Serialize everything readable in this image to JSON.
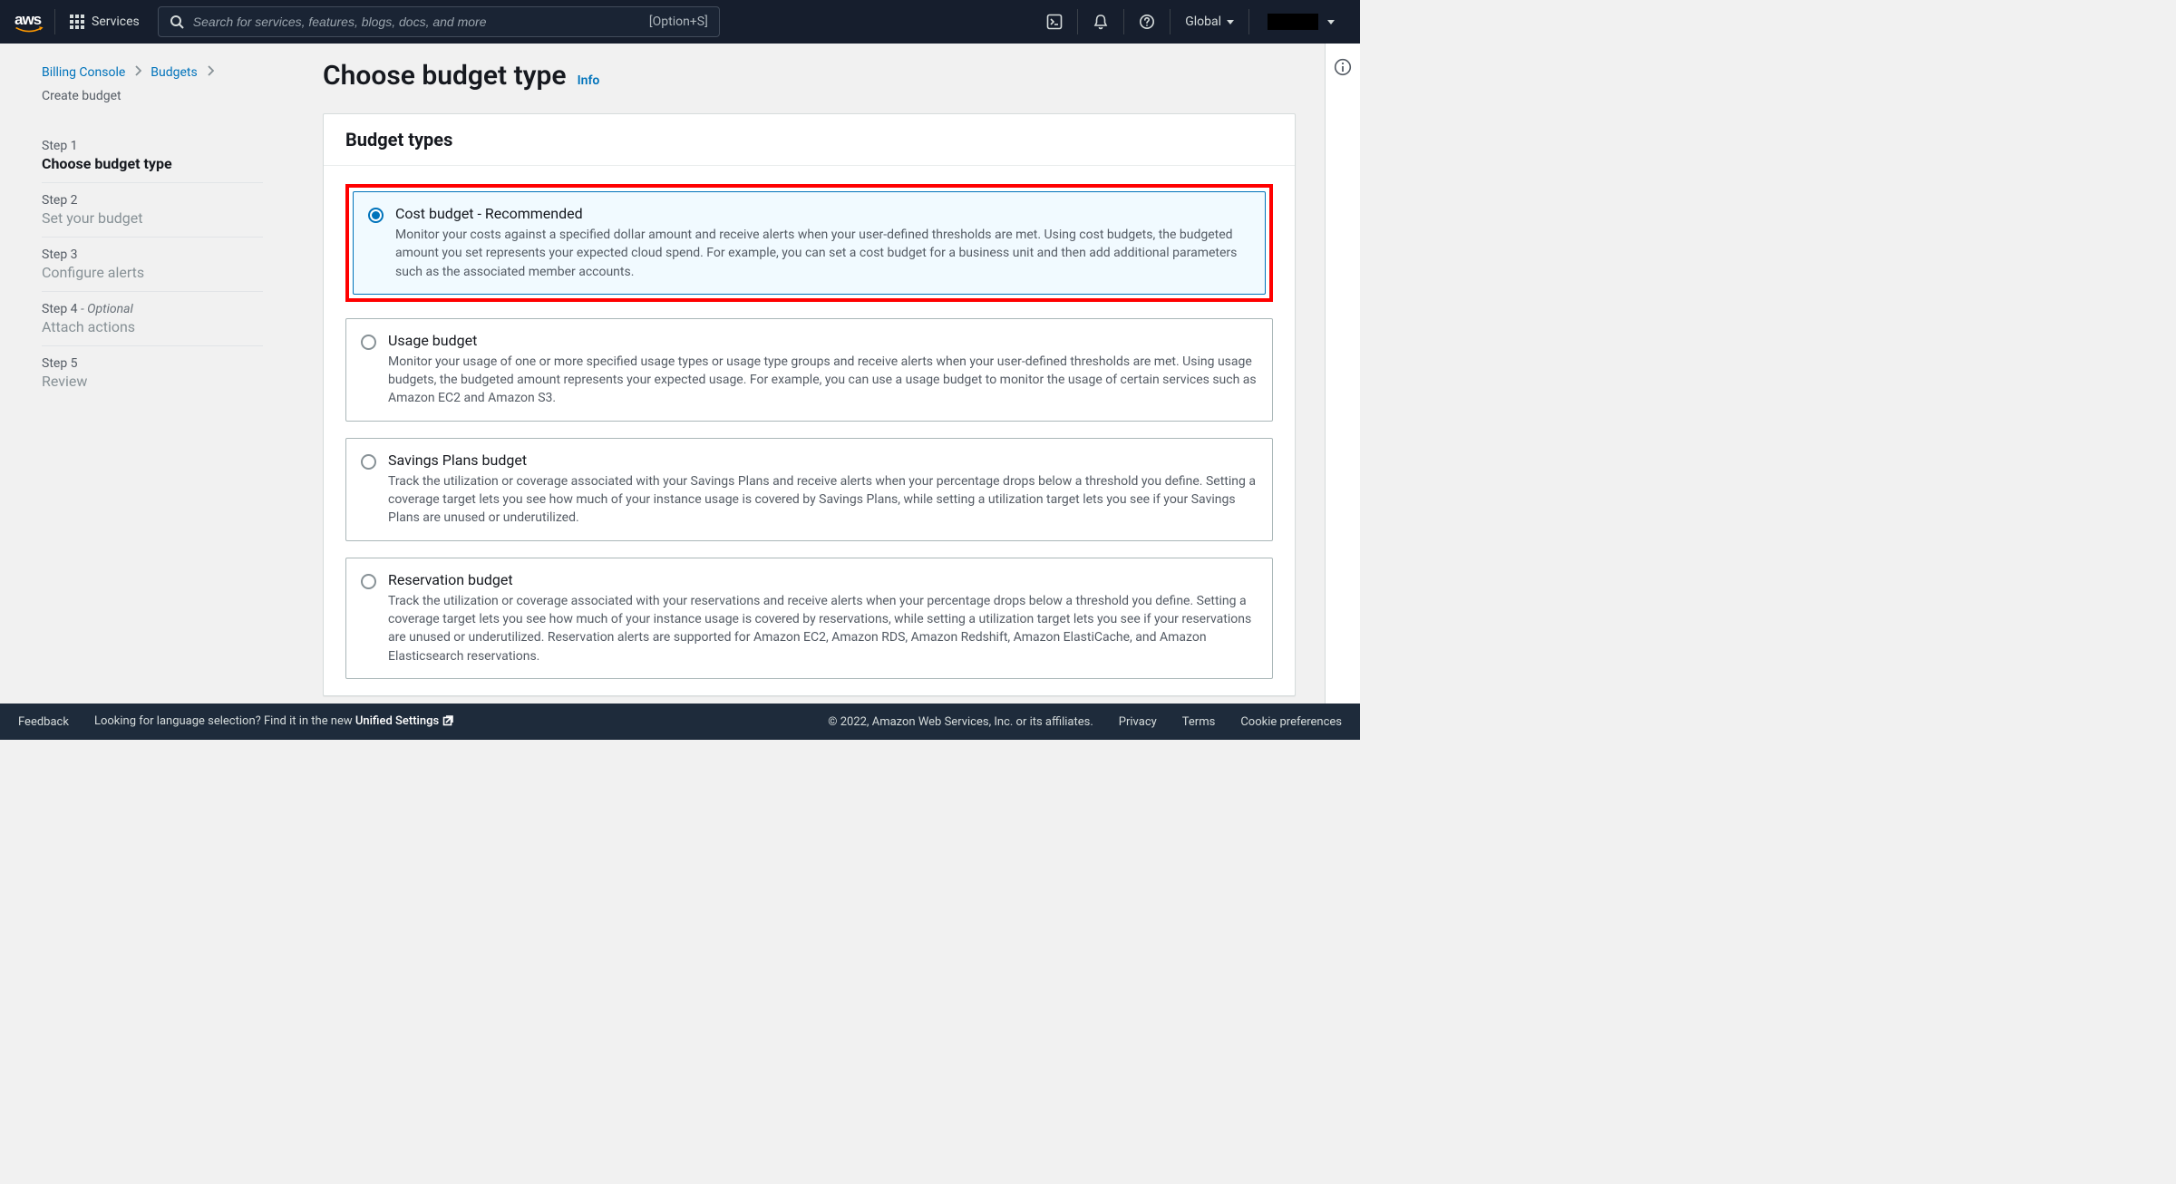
{
  "topnav": {
    "services_label": "Services",
    "search_placeholder": "Search for services, features, blogs, docs, and more",
    "search_shortcut": "[Option+S]",
    "region_label": "Global"
  },
  "breadcrumb": {
    "item1": "Billing Console",
    "item2": "Budgets",
    "current": "Create budget"
  },
  "steps": [
    {
      "label": "Step 1",
      "title": "Choose budget type",
      "optional": false,
      "active": true
    },
    {
      "label": "Step 2",
      "title": "Set your budget",
      "optional": false,
      "active": false
    },
    {
      "label": "Step 3",
      "title": "Configure alerts",
      "optional": false,
      "active": false
    },
    {
      "label": "Step 4",
      "title": "Attach actions",
      "optional": true,
      "active": false
    },
    {
      "label": "Step 5",
      "title": "Review",
      "optional": false,
      "active": false
    }
  ],
  "heading": {
    "title": "Choose budget type",
    "info": "Info"
  },
  "panel": {
    "title": "Budget types",
    "options": [
      {
        "title": "Cost budget - Recommended",
        "description": "Monitor your costs against a specified dollar amount and receive alerts when your user-defined thresholds are met. Using cost budgets, the budgeted amount you set represents your expected cloud spend. For example, you can set a cost budget for a business unit and then add additional parameters such as the associated member accounts.",
        "selected": true,
        "highlighted": true
      },
      {
        "title": "Usage budget",
        "description": "Monitor your usage of one or more specified usage types or usage type groups and receive alerts when your user-defined thresholds are met. Using usage budgets, the budgeted amount represents your expected usage. For example, you can use a usage budget to monitor the usage of certain services such as Amazon EC2 and Amazon S3.",
        "selected": false,
        "highlighted": false
      },
      {
        "title": "Savings Plans budget",
        "description": "Track the utilization or coverage associated with your Savings Plans and receive alerts when your percentage drops below a threshold you define. Setting a coverage target lets you see how much of your instance usage is covered by Savings Plans, while setting a utilization target lets you see if your Savings Plans are unused or underutilized.",
        "selected": false,
        "highlighted": false
      },
      {
        "title": "Reservation budget",
        "description": "Track the utilization or coverage associated with your reservations and receive alerts when your percentage drops below a threshold you define. Setting a coverage target lets you see how much of your instance usage is covered by reservations, while setting a utilization target lets you see if your reservations are unused or underutilized. Reservation alerts are supported for Amazon EC2, Amazon RDS, Amazon Redshift, Amazon ElastiCache, and Amazon Elasticsearch reservations.",
        "selected": false,
        "highlighted": false
      }
    ]
  },
  "footer": {
    "feedback": "Feedback",
    "lang_prompt": "Looking for language selection? Find it in the new ",
    "unified": "Unified Settings",
    "copyright": "© 2022, Amazon Web Services, Inc. or its affiliates.",
    "privacy": "Privacy",
    "terms": "Terms",
    "cookies": "Cookie preferences"
  },
  "step_optional_suffix": " - Optional"
}
